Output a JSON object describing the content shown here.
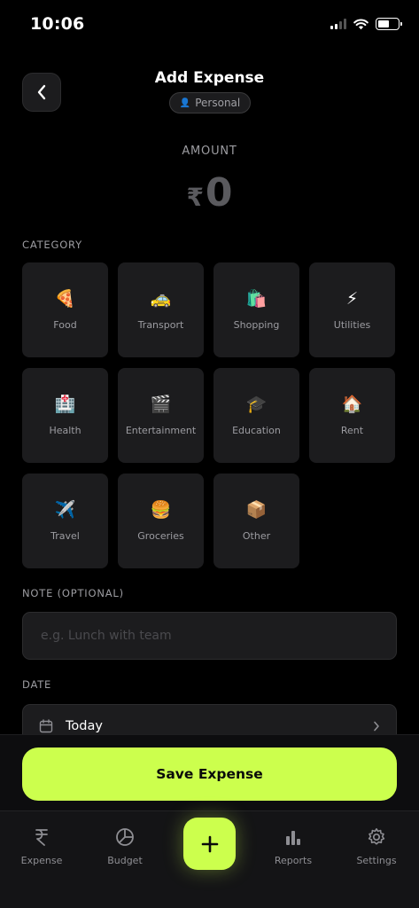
{
  "status_bar": {
    "time": "10:06",
    "battery_level": 0.55
  },
  "header": {
    "title": "Add Expense",
    "account_pill": "Personal"
  },
  "amount": {
    "label": "AMOUNT",
    "currency": "₹",
    "value": "0"
  },
  "category": {
    "label": "CATEGORY",
    "items": [
      {
        "emoji": "🍕",
        "label": "Food"
      },
      {
        "emoji": "🚕",
        "label": "Transport"
      },
      {
        "emoji": "🛍️",
        "label": "Shopping"
      },
      {
        "emoji": "⚡",
        "label": "Utilities"
      },
      {
        "emoji": "🏥",
        "label": "Health"
      },
      {
        "emoji": "🎬",
        "label": "Entertainment"
      },
      {
        "emoji": "🎓",
        "label": "Education"
      },
      {
        "emoji": "🏠",
        "label": "Rent"
      },
      {
        "emoji": "✈️",
        "label": "Travel"
      },
      {
        "emoji": "🍔",
        "label": "Groceries"
      },
      {
        "emoji": "📦",
        "label": "Other"
      }
    ]
  },
  "note": {
    "label": "NOTE (OPTIONAL)",
    "placeholder": "e.g. Lunch with team",
    "value": ""
  },
  "date": {
    "label": "DATE",
    "value": "Today"
  },
  "save_button": {
    "label": "Save Expense"
  },
  "tab_bar": {
    "tabs": [
      {
        "label": "Expense",
        "icon": "rupee-icon"
      },
      {
        "label": "Budget",
        "icon": "pie-chart-icon"
      },
      {
        "label": "Reports",
        "icon": "bar-chart-icon"
      },
      {
        "label": "Settings",
        "icon": "gear-icon"
      }
    ],
    "add_icon": "plus-icon"
  },
  "colors": {
    "accent": "#ccff4d",
    "background": "#000000",
    "surface": "#1c1c1e",
    "muted_text": "#9c9ca1"
  }
}
